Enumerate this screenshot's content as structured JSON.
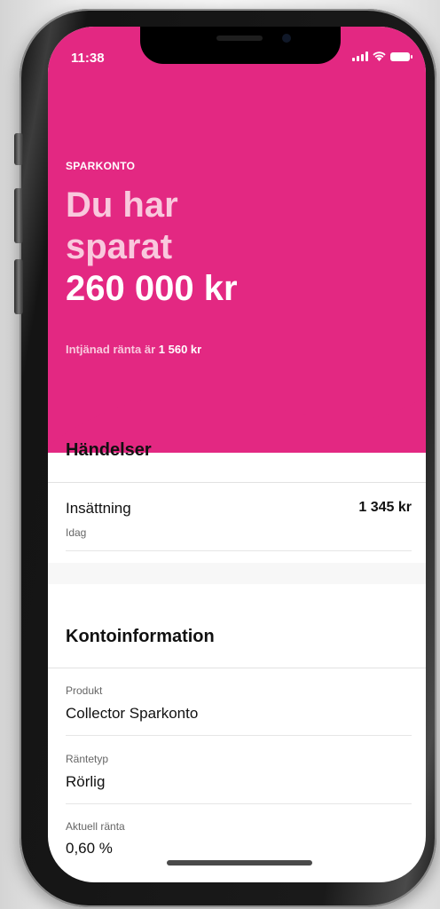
{
  "status_bar": {
    "time": "11:38"
  },
  "hero": {
    "eyebrow": "SPARKONTO",
    "headline_line1": "Du har",
    "headline_line2": "sparat",
    "amount": "260 000 kr",
    "interest_prefix": "Intjänad ränta är",
    "interest_amount": "1 560 kr",
    "accent_color": "#e32882"
  },
  "events": {
    "title": "Händelser",
    "items": [
      {
        "label": "Insättning",
        "date": "Idag",
        "amount": "1 345 kr"
      }
    ]
  },
  "account_info": {
    "title": "Kontoinformation",
    "fields": [
      {
        "label": "Produkt",
        "value": "Collector Sparkonto"
      },
      {
        "label": "Räntetyp",
        "value": "Rörlig"
      },
      {
        "label": "Aktuell ränta",
        "value": "0,60 %"
      }
    ]
  }
}
